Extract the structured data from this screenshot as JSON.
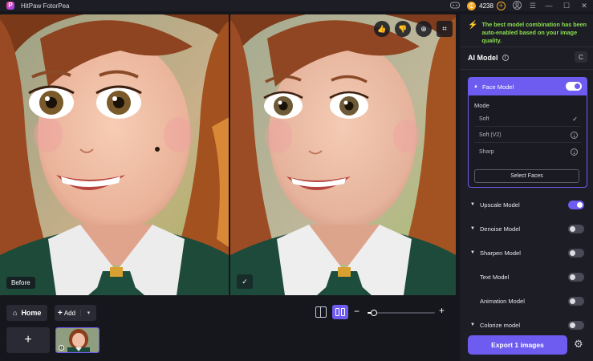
{
  "app": {
    "logo_letter": "P",
    "title": "HitPaw FotorPea"
  },
  "titlebar": {
    "discord_icon": "gamepad-icon",
    "coin_symbol": "₵",
    "credits": "4238",
    "add_credits_symbol": "+",
    "user_icon": "user-icon",
    "menu_icon": "☰",
    "minimize": "—",
    "maximize": "☐",
    "close": "✕"
  },
  "preview": {
    "before_label": "Before",
    "after_check": "✓",
    "tool_like": "👍",
    "tool_dislike": "👎",
    "tool_zoom": "⊕",
    "tool_crop": "⌗"
  },
  "bottom": {
    "home_icon": "⌂",
    "home_label": "Home",
    "add_plus": "+",
    "add_label": "Add",
    "add_dropdown": "▾",
    "zoom_minus": "−",
    "zoom_plus": "+",
    "zoom_level": 0.1,
    "add_tile_symbol": "+",
    "thumb_info": "i"
  },
  "panel": {
    "bolt_icon": "⚡",
    "notice": "The best model combination has been auto-enabled based on your image quality.",
    "ai_model_title": "AI Model",
    "info_symbol": "i",
    "refresh_symbol": "C",
    "face_model": {
      "label": "Face Model",
      "enabled": true,
      "mode_label": "Mode",
      "options": [
        {
          "label": "Soft",
          "state": "selected",
          "icon": "✓"
        },
        {
          "label": "Soft (V2)",
          "state": "download",
          "icon": "↓"
        },
        {
          "label": "Sharp",
          "state": "download",
          "icon": "↓"
        }
      ],
      "select_faces": "Select Faces"
    },
    "models": [
      {
        "label": "Upscale Model",
        "caret": true,
        "enabled": true
      },
      {
        "label": "Denoise Model",
        "caret": true,
        "enabled": false
      },
      {
        "label": "Sharpen Model",
        "caret": true,
        "enabled": false
      },
      {
        "label": "Text Model",
        "caret": false,
        "enabled": false
      },
      {
        "label": "Animation Model",
        "caret": false,
        "enabled": false
      },
      {
        "label": "Colorize model",
        "caret": true,
        "enabled": false
      }
    ],
    "export_label": "Export 1 images",
    "settings_icon": "⚙"
  },
  "colors": {
    "accent": "#6e5cf0",
    "notice_green": "#8be04e",
    "coin_orange": "#f5a623",
    "panel_bg": "#1d1d26",
    "app_bg": "#16161d"
  }
}
